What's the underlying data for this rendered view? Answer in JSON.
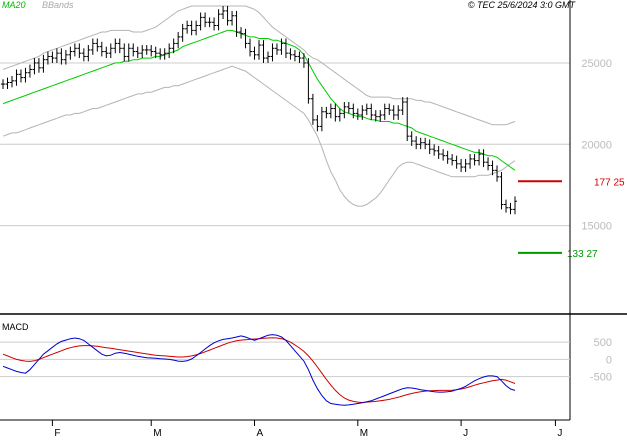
{
  "header": {
    "legend_ma": "MA20",
    "legend_bb": "BBands",
    "copyright": "© TEC 25/6/2024 3:0 GMT"
  },
  "colors": {
    "ma": "#00cc00",
    "bands": "#b4b4b4",
    "price": "#000000",
    "macd": "#0000cc",
    "signal": "#cc0000",
    "resistance": "#cc0000",
    "support": "#009900",
    "grid": "#cccccc"
  },
  "chart_data": {
    "type": "line",
    "price_panel": {
      "y_ticks": [
        150,
        200,
        250
      ],
      "y_tick_labels": [
        "15000",
        "20000",
        "25000"
      ],
      "ylim": [
        100,
        285
      ],
      "resistance": {
        "value": 177.25,
        "label": "177 25"
      },
      "support": {
        "value": 133.27,
        "label": "133 27"
      },
      "x_index_range": [
        0,
        128
      ],
      "month_labels": [
        {
          "label": "F",
          "index": 11
        },
        {
          "label": "M",
          "index": 33
        },
        {
          "label": "A",
          "index": 56
        },
        {
          "label": "M",
          "index": 79
        },
        {
          "label": "J",
          "index": 102
        },
        {
          "label": "J",
          "index": 123
        }
      ],
      "close": [
        237,
        238,
        239,
        243,
        241,
        244,
        246,
        250,
        247,
        252,
        254,
        253,
        256,
        252,
        255,
        257,
        259,
        256,
        254,
        258,
        262,
        260,
        257,
        256,
        259,
        262,
        259,
        254,
        259,
        257,
        256,
        258,
        258,
        257,
        256,
        255,
        256,
        259,
        262,
        266,
        271,
        273,
        270,
        273,
        278,
        275,
        275,
        273,
        280,
        282,
        276,
        279,
        269,
        268,
        262,
        257,
        255,
        261,
        253,
        254,
        259,
        258,
        262,
        256,
        255,
        254,
        253,
        250,
        228,
        215,
        211,
        220,
        219,
        222,
        217,
        219,
        223,
        222,
        219,
        218,
        221,
        222,
        218,
        217,
        218,
        222,
        221,
        218,
        221,
        226,
        205,
        202,
        200,
        201,
        200,
        197,
        196,
        194,
        193,
        191,
        190,
        188,
        186,
        188,
        191,
        190,
        194,
        189,
        187,
        184,
        180,
        163,
        161,
        160,
        165
      ],
      "ma20": [
        225,
        226,
        227,
        228,
        229,
        230,
        231,
        232,
        233,
        234,
        235,
        236,
        237,
        238,
        239,
        240,
        241,
        242,
        243,
        244,
        245,
        246,
        247,
        248,
        249,
        250,
        250,
        251,
        251,
        252,
        252,
        253,
        253,
        253,
        254,
        254,
        255,
        256,
        257,
        258,
        260,
        261,
        262,
        263,
        264,
        265,
        266,
        267,
        268,
        269,
        270,
        270,
        269,
        268,
        267,
        266,
        266,
        265,
        265,
        265,
        264,
        264,
        263,
        262,
        261,
        260,
        258,
        255,
        250,
        245,
        240,
        236,
        232,
        228,
        225,
        222,
        220,
        219,
        218,
        217,
        217,
        216,
        215,
        215,
        214,
        214,
        214,
        213,
        213,
        212,
        211,
        210,
        208,
        207,
        206,
        205,
        204,
        203,
        202,
        201,
        200,
        199,
        198,
        197,
        196,
        195,
        195,
        194,
        193,
        193,
        192,
        190,
        188,
        186,
        184
      ],
      "bb_upper": [
        246,
        247,
        248,
        249,
        250,
        251,
        252,
        253,
        254,
        256,
        257,
        258,
        259,
        260,
        261,
        262,
        263,
        264,
        265,
        266,
        267,
        268,
        269,
        269,
        270,
        270,
        270,
        270,
        270,
        269,
        269,
        269,
        270,
        271,
        272,
        274,
        276,
        278,
        280,
        282,
        283,
        284,
        285,
        285,
        285,
        285,
        285,
        285,
        285,
        285,
        285,
        285,
        285,
        285,
        285,
        284,
        283,
        281,
        278,
        275,
        272,
        270,
        268,
        266,
        264,
        262,
        260,
        258,
        255,
        253,
        252,
        250,
        248,
        246,
        244,
        242,
        240,
        238,
        236,
        234,
        232,
        230,
        229,
        229,
        229,
        229,
        229,
        228,
        228,
        228,
        228,
        228,
        227,
        227,
        226,
        226,
        225,
        224,
        223,
        222,
        221,
        220,
        219,
        218,
        217,
        216,
        215,
        214,
        213,
        212,
        212,
        212,
        212,
        213,
        214
      ],
      "bb_lower": [
        205,
        206,
        207,
        207,
        208,
        209,
        210,
        211,
        212,
        213,
        214,
        215,
        216,
        217,
        218,
        218,
        219,
        219,
        220,
        221,
        222,
        222,
        223,
        224,
        225,
        226,
        227,
        228,
        229,
        230,
        231,
        231,
        232,
        232,
        233,
        234,
        235,
        235,
        236,
        236,
        237,
        238,
        239,
        240,
        241,
        242,
        243,
        244,
        245,
        246,
        247,
        248,
        247,
        246,
        245,
        243,
        241,
        239,
        237,
        235,
        233,
        231,
        229,
        227,
        225,
        223,
        221,
        219,
        215,
        210,
        205,
        198,
        190,
        183,
        178,
        172,
        168,
        165,
        163,
        162,
        162,
        163,
        165,
        167,
        170,
        174,
        178,
        182,
        186,
        188,
        189,
        189,
        188,
        187,
        186,
        185,
        184,
        183,
        182,
        181,
        180,
        180,
        180,
        180,
        180,
        180,
        181,
        181,
        181,
        182,
        183,
        184,
        186,
        188,
        190
      ]
    },
    "macd_panel": {
      "title": "MACD",
      "y_ticks": [
        500,
        0,
        -500
      ],
      "y_tick_labels": [
        "500",
        "0",
        "-500"
      ],
      "ylim": [
        -1700,
        1200
      ],
      "macd": [
        -200,
        -250,
        -300,
        -350,
        -380,
        -400,
        -300,
        -150,
        0,
        150,
        250,
        350,
        450,
        520,
        560,
        600,
        620,
        600,
        550,
        450,
        350,
        250,
        150,
        100,
        120,
        180,
        200,
        180,
        150,
        120,
        90,
        70,
        50,
        40,
        30,
        20,
        10,
        0,
        -20,
        -50,
        -60,
        -40,
        10,
        100,
        200,
        300,
        400,
        480,
        540,
        580,
        600,
        620,
        650,
        680,
        650,
        600,
        550,
        600,
        650,
        700,
        720,
        700,
        650,
        550,
        400,
        250,
        100,
        -50,
        -300,
        -600,
        -850,
        -1050,
        -1200,
        -1280,
        -1300,
        -1320,
        -1330,
        -1320,
        -1300,
        -1280,
        -1260,
        -1230,
        -1200,
        -1150,
        -1100,
        -1050,
        -1000,
        -950,
        -900,
        -850,
        -820,
        -830,
        -850,
        -880,
        -900,
        -920,
        -940,
        -950,
        -950,
        -940,
        -920,
        -880,
        -840,
        -780,
        -700,
        -620,
        -560,
        -510,
        -480,
        -480,
        -500,
        -620,
        -760,
        -860,
        -900
      ],
      "signal": [
        150,
        100,
        50,
        0,
        -30,
        -50,
        -60,
        -40,
        0,
        50,
        100,
        150,
        200,
        250,
        300,
        340,
        370,
        390,
        400,
        400,
        390,
        380,
        360,
        340,
        320,
        300,
        280,
        260,
        240,
        220,
        200,
        180,
        160,
        140,
        120,
        110,
        100,
        90,
        80,
        70,
        70,
        80,
        100,
        130,
        170,
        220,
        270,
        320,
        370,
        420,
        470,
        510,
        540,
        560,
        570,
        580,
        590,
        600,
        610,
        620,
        630,
        620,
        600,
        560,
        500,
        420,
        330,
        230,
        100,
        -50,
        -220,
        -400,
        -580,
        -750,
        -900,
        -1020,
        -1120,
        -1180,
        -1220,
        -1240,
        -1250,
        -1240,
        -1230,
        -1220,
        -1200,
        -1180,
        -1160,
        -1130,
        -1100,
        -1060,
        -1020,
        -990,
        -960,
        -940,
        -920,
        -910,
        -905,
        -900,
        -900,
        -900,
        -895,
        -880,
        -860,
        -830,
        -790,
        -750,
        -710,
        -680,
        -650,
        -620,
        -600,
        -580,
        -600,
        -650,
        -700
      ]
    }
  }
}
